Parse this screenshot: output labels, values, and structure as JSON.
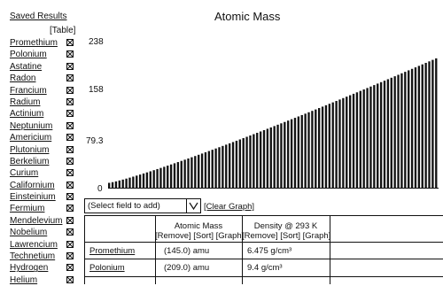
{
  "sidebar": {
    "title": "Saved Results",
    "table_link": "[Table]",
    "items": [
      {
        "label": "Promethium"
      },
      {
        "label": "Polonium"
      },
      {
        "label": "Astatine"
      },
      {
        "label": "Radon"
      },
      {
        "label": "Francium"
      },
      {
        "label": "Radium"
      },
      {
        "label": "Actinium"
      },
      {
        "label": "Neptunium"
      },
      {
        "label": "Americium"
      },
      {
        "label": "Plutonium"
      },
      {
        "label": "Berkelium"
      },
      {
        "label": "Curium"
      },
      {
        "label": "Californium"
      },
      {
        "label": "Einsteinium"
      },
      {
        "label": "Fermium"
      },
      {
        "label": "Mendelevium"
      },
      {
        "label": "Nobelium"
      },
      {
        "label": "Lawrencium"
      },
      {
        "label": "Technetium"
      },
      {
        "label": "Hydrogen"
      },
      {
        "label": "Helium"
      }
    ],
    "remove_icon": "checkbox-x-icon"
  },
  "chart_data": {
    "type": "bar",
    "title": "Atomic Mass",
    "ytick_labels": [
      "238",
      "158",
      "79.3",
      "0"
    ],
    "ylim": [
      0,
      238
    ],
    "xlabel": "",
    "ylabel": "",
    "bar_count": 96,
    "values_start": 8,
    "values_end": 212,
    "grid": false
  },
  "controls": {
    "select_value": "(Select field to add)",
    "clear_graph": "[Clear Graph]"
  },
  "table": {
    "columns": [
      {
        "title": "Atomic Mass",
        "actions": "[Remove] [Sort] [Graph]"
      },
      {
        "title": "Density @ 293 K",
        "actions": "[Remove] [Sort] [Graph]"
      }
    ],
    "rows": [
      {
        "name": "Promethium",
        "mass": "(145.0) amu",
        "density": "6.475 g/cm³"
      },
      {
        "name": "Polonium",
        "mass": "(209.0) amu",
        "density": "9.4 g/cm³"
      }
    ]
  }
}
